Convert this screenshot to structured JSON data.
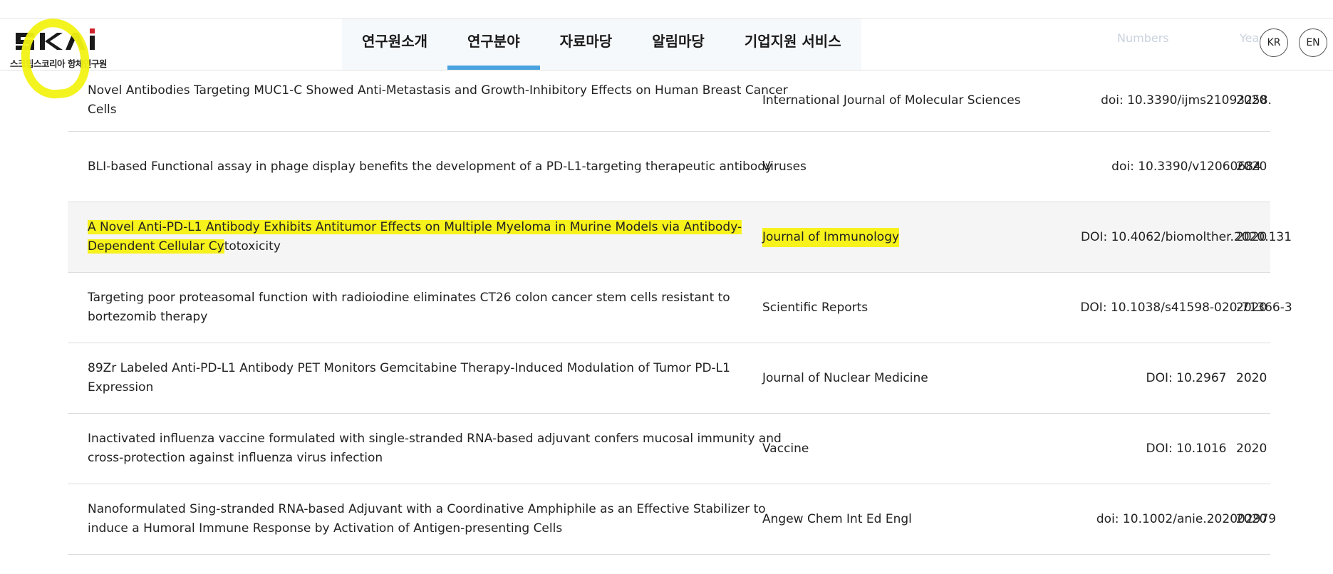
{
  "header": {
    "logo_text": "SKAI",
    "logo_subtitle": "스크립스코리아 항체연구원",
    "nav": [
      {
        "label": "연구원소개",
        "active": false
      },
      {
        "label": "연구분야",
        "active": true
      },
      {
        "label": "자료마당",
        "active": false
      },
      {
        "label": "알림마당",
        "active": false
      },
      {
        "label": "기업지원 서비스",
        "active": false
      }
    ],
    "ghost_numbers": "Numbers",
    "ghost_year": "Year",
    "lang_kr": "KR",
    "lang_en": "EN"
  },
  "colors": {
    "accent": "#4aa3e0",
    "highlight": "#f7f21b"
  },
  "rows": [
    {
      "title": "Novel Antibodies Targeting MUC1-C Showed Anti-Metastasis and Growth-Inhibitory Effects on Human Breast Cancer Cells",
      "journal": "International Journal of Molecular Sciences",
      "number": "doi: 10.3390/ijms21093258.",
      "year": "2020"
    },
    {
      "title": "BLI-based Functional assay in phage display benefits the development of a PD-L1-targeting therapeutic antibody",
      "journal": "Viruses",
      "number": "doi: 10.3390/v12060684",
      "year": "2020"
    },
    {
      "title_hl": "A Novel Anti-PD-L1 Antibody Exhibits Antitumor Effects on Multiple Myeloma in Murine Models via Antibody-Dependent Cellular Cy",
      "title_rest": "totoxicity",
      "journal": "Journal of Immunology",
      "number": "DOI: 10.4062/biomolther.2020.131",
      "year": "2020"
    },
    {
      "title": "Targeting poor proteasomal function with radioiodine eliminates CT26 colon cancer stem cells resistant to bortezomib therapy",
      "journal": "Scientific Reports",
      "number": "DOI: 10.1038/s41598-020-71366-3",
      "year": "2020"
    },
    {
      "title": "89Zr Labeled Anti-PD-L1 Antibody PET Monitors Gemcitabine Therapy-Induced Modulation of Tumor PD-L1 Expression",
      "journal": "Journal of Nuclear Medicine",
      "number": "DOI: 10.2967",
      "year": "2020"
    },
    {
      "title": "Inactivated influenza vaccine formulated with single-stranded RNA-based adjuvant confers mucosal immunity and cross-protection against influenza virus infection",
      "journal": "Vaccine",
      "number": "DOI: 10.1016",
      "year": "2020"
    },
    {
      "title": "Nanoformulated Sing-stranded RNA-based Adjuvant with a Coordinative Amphiphile as an Effective Stabilizer to induce a Humoral Immune Response by Activation of Antigen-presenting Cells",
      "journal": "Angew Chem Int Ed Engl",
      "number": "doi: 10.1002/anie.202002979",
      "year": "2020"
    }
  ]
}
